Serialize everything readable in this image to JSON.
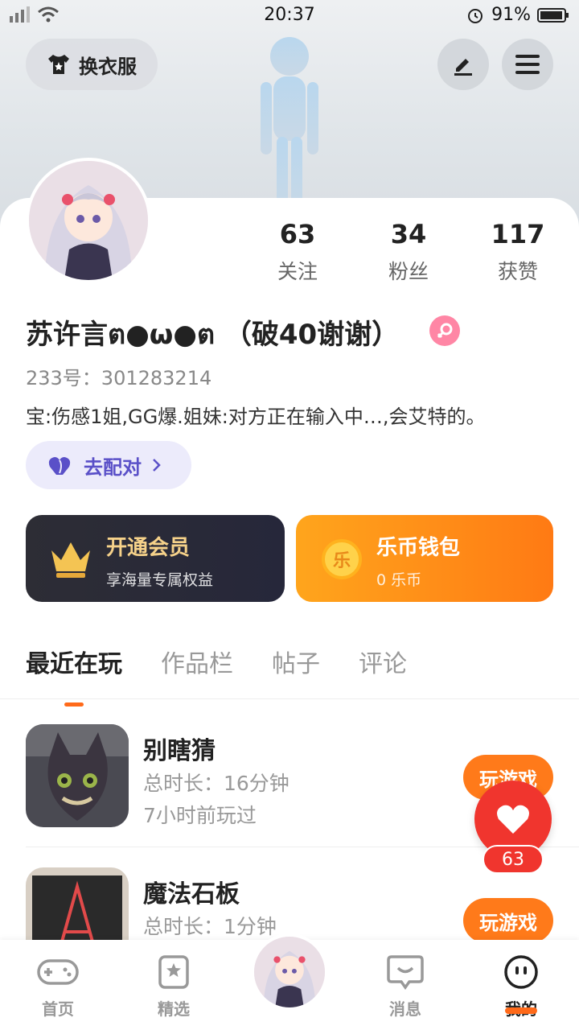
{
  "status_bar": {
    "time": "20:37",
    "battery": "91%"
  },
  "header": {
    "dress_label": "换衣服"
  },
  "stats": [
    {
      "num": "63",
      "label": "关注"
    },
    {
      "num": "34",
      "label": "粉丝"
    },
    {
      "num": "117",
      "label": "获赞"
    }
  ],
  "profile": {
    "nickname": "苏许言ต●ω●ต （破40谢谢）",
    "uid": "233号：301283214",
    "bio": "宝:伤感1姐,GG爆.姐妹:对方正在输入中…,会艾特的。",
    "match_label": "去配对"
  },
  "vip": {
    "title": "开通会员",
    "subtitle": "享海量专属权益"
  },
  "wallet": {
    "title": "乐币钱包",
    "subtitle": "0 乐币",
    "coin_char": "乐"
  },
  "tabs": [
    "最近在玩",
    "作品栏",
    "帖子",
    "评论"
  ],
  "games": [
    {
      "name": "别瞎猜",
      "duration": "总时长：16分钟",
      "ago": "7小时前玩过",
      "play": "玩游戏"
    },
    {
      "name": "魔法石板",
      "duration": "总时长：1分钟",
      "ago": "",
      "play": "玩游戏"
    }
  ],
  "like": {
    "count": "63"
  },
  "bottom_nav": [
    "首页",
    "精选",
    "消息",
    "我的"
  ],
  "colors": {
    "accent": "#ff7a1a",
    "like": "#f0352e",
    "match": "#5a50c8"
  }
}
